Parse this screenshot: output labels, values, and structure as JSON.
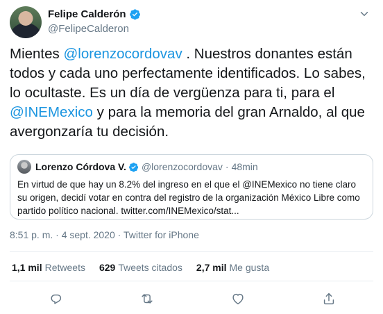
{
  "author": {
    "display_name": "Felipe Calderón",
    "handle": "@FelipeCalderon"
  },
  "tweet": {
    "parts": [
      {
        "text": "Mientes ",
        "type": "text"
      },
      {
        "text": "@lorenzocordovav",
        "type": "mention"
      },
      {
        "text": " . Nuestros donantes están todos y cada uno perfectamente identificados. Lo sabes, lo ocultaste. Es un día de vergüenza para ti, para el ",
        "type": "text"
      },
      {
        "text": "@INEMexico",
        "type": "mention"
      },
      {
        "text": " y para la memoria del gran Arnaldo, al que avergonzaría tu decisión.",
        "type": "text"
      }
    ]
  },
  "quoted": {
    "display_name": "Lorenzo Córdova V.",
    "handle": "@lorenzocordovav",
    "separator": "·",
    "time": "48min",
    "body": "En virtud de que hay un 8.2% del ingreso en el que el @INEMexico no tiene claro su origen, decidí votar en contra del registro de la organización México Libre como partido político nacional. twitter.com/INEMexico/stat..."
  },
  "meta": {
    "timestamp": "8:51 p. m. · 4 sept. 2020 · Twitter for iPhone"
  },
  "stats": {
    "retweets_count": "1,1 mil",
    "retweets_label": "Retweets",
    "quotes_count": "629",
    "quotes_label": "Tweets citados",
    "likes_count": "2,7 mil",
    "likes_label": "Me gusta"
  },
  "icons": {
    "verified": "verified-badge-icon",
    "more": "chevron-down-icon",
    "reply": "reply-icon",
    "retweet": "retweet-icon",
    "like": "heart-icon",
    "share": "share-icon"
  },
  "colors": {
    "accent": "#1da1f2",
    "mention": "#1b95e0",
    "secondary_text": "#657786",
    "border": "#ccd6dd"
  }
}
